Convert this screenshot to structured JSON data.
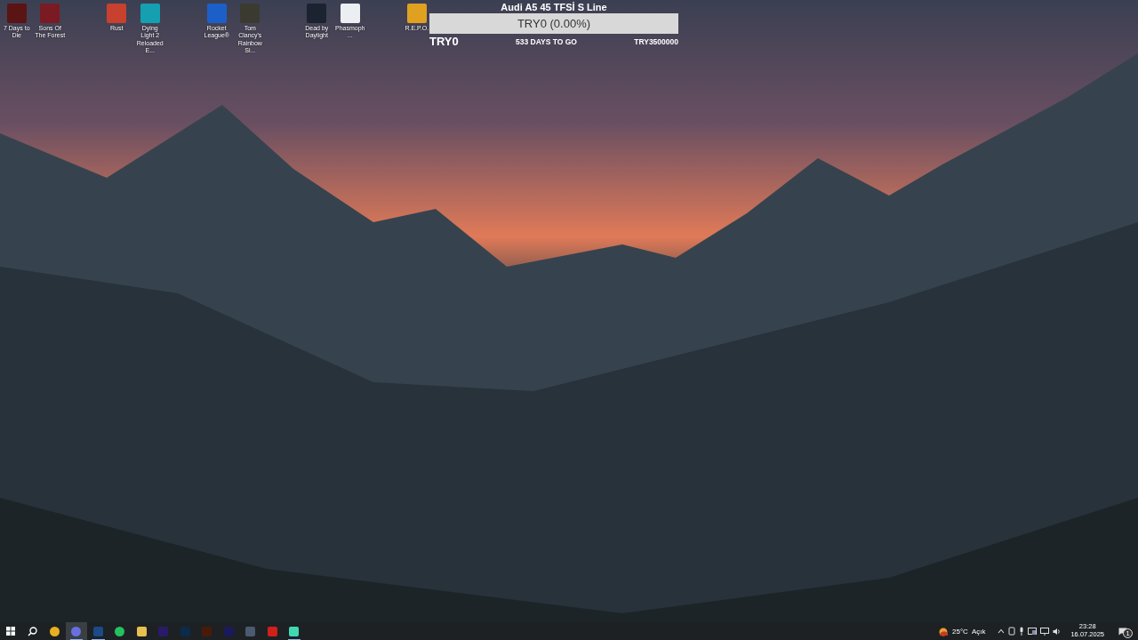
{
  "desktop_icons": [
    {
      "label": "7 Days to Die",
      "kind": "zombie"
    },
    {
      "label": "Sons Of The Forest",
      "kind": "forest"
    },
    {
      "label": "Rust",
      "kind": "rust"
    },
    {
      "label": "Dying Light 2 Reloaded E...",
      "kind": "dyinglight"
    },
    {
      "label": "Rocket League®",
      "kind": "rocket"
    },
    {
      "label": "Tom Clancy's Rainbow Si...",
      "kind": "rainbow"
    },
    {
      "label": "Dead by Daylight",
      "kind": "dbd"
    },
    {
      "label": "Phasmoph...",
      "kind": "file"
    },
    {
      "label": "R.E.P.O.",
      "kind": "repo"
    }
  ],
  "goal_widget": {
    "title": "Audi A5 45 TFSİ S Line",
    "progress_text": "TRY0 (0.00%)",
    "level": 0,
    "raised": "TRY0",
    "days_left": "533 DAYS TO GO",
    "target": "TRY3500000"
  },
  "taskbar": {
    "apps": [
      {
        "kind": "chrome",
        "selected": false,
        "running": false
      },
      {
        "kind": "discord",
        "selected": true,
        "running": true
      },
      {
        "kind": "steam",
        "selected": false,
        "running": true
      },
      {
        "kind": "whatsapp",
        "selected": false,
        "running": false
      },
      {
        "kind": "explorer",
        "selected": false,
        "running": false
      },
      {
        "kind": "premiere",
        "selected": false,
        "running": false
      },
      {
        "kind": "photoshop",
        "selected": false,
        "running": false
      },
      {
        "kind": "illustrator",
        "selected": false,
        "running": false
      },
      {
        "kind": "aftereffects",
        "selected": false,
        "running": false
      },
      {
        "kind": "davinci",
        "selected": false,
        "running": false
      },
      {
        "kind": "acrobat",
        "selected": false,
        "running": false
      },
      {
        "kind": "notes",
        "selected": false,
        "running": true
      }
    ],
    "weather": {
      "temperature": "25°C",
      "condition": "Açık"
    },
    "time": "23:28",
    "date": "16.07.2025",
    "notification_count": "1"
  }
}
